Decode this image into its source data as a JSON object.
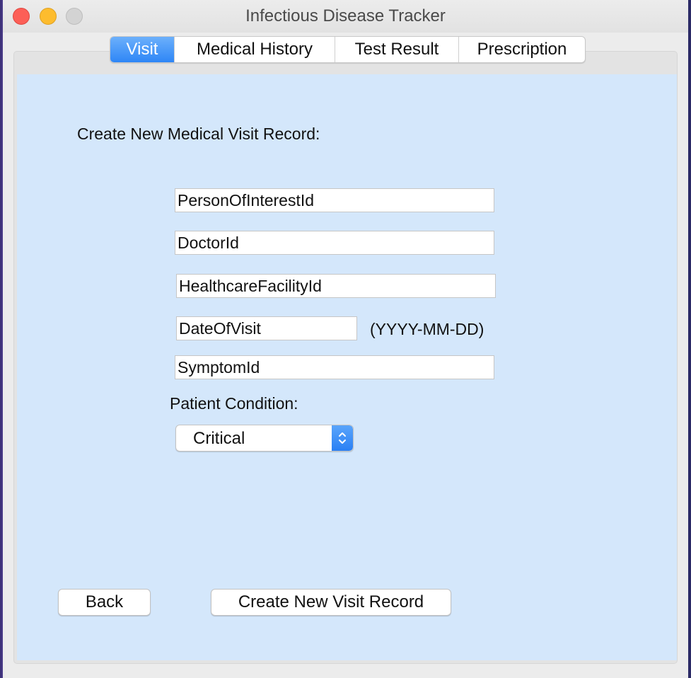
{
  "window": {
    "title": "Infectious Disease Tracker"
  },
  "tabs": [
    {
      "label": "Visit",
      "active": true
    },
    {
      "label": "Medical History",
      "active": false
    },
    {
      "label": "Test Result",
      "active": false
    },
    {
      "label": "Prescription",
      "active": false
    }
  ],
  "form": {
    "heading": "Create New Medical Visit Record:",
    "fields": {
      "person_of_interest_id": "PersonOfInterestId",
      "doctor_id": "DoctorId",
      "healthcare_facility_id": "HealthcareFacilityId",
      "date_of_visit": "DateOfVisit",
      "symptom_id": "SymptomId"
    },
    "date_format_hint": "(YYYY-MM-DD)",
    "condition_label": "Patient Condition:",
    "condition_selected": "Critical"
  },
  "buttons": {
    "back": "Back",
    "create": "Create New Visit Record"
  },
  "colors": {
    "accent": "#2e86f6",
    "content_background": "#d4e7fb",
    "close": "#fc5f57",
    "minimize": "#fdbc2e",
    "maximize_disabled": "#d3d3d3"
  },
  "icons": {
    "select_arrows": "up-down-chevron-icon"
  }
}
